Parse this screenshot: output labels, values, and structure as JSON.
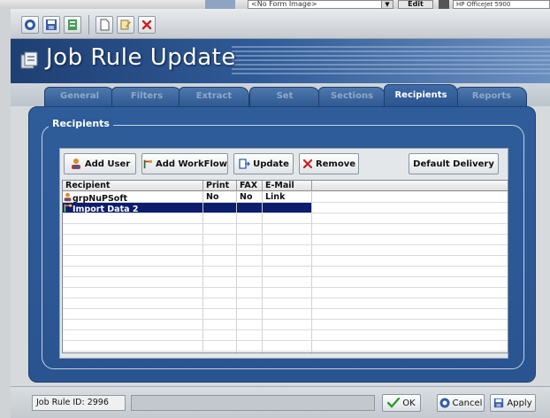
{
  "background_app": {
    "image_combo": "<No Form Image>",
    "edit_label": "Edit",
    "printer": "HP OfficeJet 5900"
  },
  "window": {
    "title": "Job Rule Update",
    "toolbar_icons": [
      "play-icon",
      "save-icon",
      "export-icon",
      "new-document-icon",
      "edit-document-icon",
      "close-icon"
    ]
  },
  "tabs": [
    {
      "label": "General",
      "active": false
    },
    {
      "label": "Filters",
      "active": false
    },
    {
      "label": "Extract",
      "active": false
    },
    {
      "label": "Set",
      "active": false
    },
    {
      "label": "Sections",
      "active": false
    },
    {
      "label": "Recipients",
      "active": true
    },
    {
      "label": "Reports",
      "active": false
    }
  ],
  "recipients": {
    "group_label": "Recipients",
    "buttons": {
      "add_user": "Add User",
      "add_workflow": "Add WorkFlow",
      "update": "Update",
      "remove": "Remove",
      "default_delivery": "Default Delivery"
    },
    "columns": [
      "Recipient",
      "Print",
      "FAX",
      "E-Mail"
    ],
    "rows": [
      {
        "recipient": "grpNuPSoft",
        "print": "No",
        "fax": "No",
        "email": "Link",
        "icon": "user-icon",
        "selected": false
      },
      {
        "recipient": "Import Data 2",
        "print": "",
        "fax": "",
        "email": "",
        "icon": "workflow-icon",
        "selected": true
      }
    ]
  },
  "statusbar": {
    "job_rule_id": "Job Rule ID: 2996",
    "ok_label": "OK",
    "cancel_label": "Cancel",
    "apply_label": "Apply"
  },
  "colors": {
    "banner_dark": "#1f3f73",
    "panel_blue": "#2f5d9a",
    "selection": "#0c1d6d"
  }
}
